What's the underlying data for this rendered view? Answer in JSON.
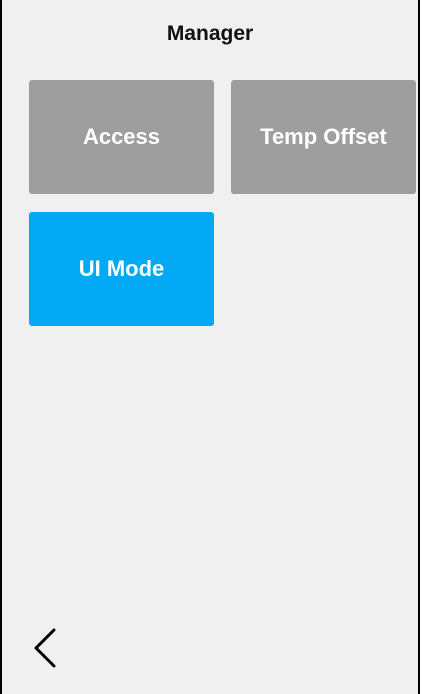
{
  "header": {
    "title": "Manager"
  },
  "tiles": [
    {
      "label": "Access",
      "color": "#9e9e9e"
    },
    {
      "label": "Temp Offset",
      "color": "#9e9e9e"
    },
    {
      "label": "UI Mode",
      "color": "#03a9f4"
    }
  ],
  "navigation": {
    "back_icon": "chevron-left-icon"
  },
  "colors": {
    "background": "#f0f0f0",
    "tile_inactive": "#9e9e9e",
    "tile_active": "#03a9f4"
  }
}
